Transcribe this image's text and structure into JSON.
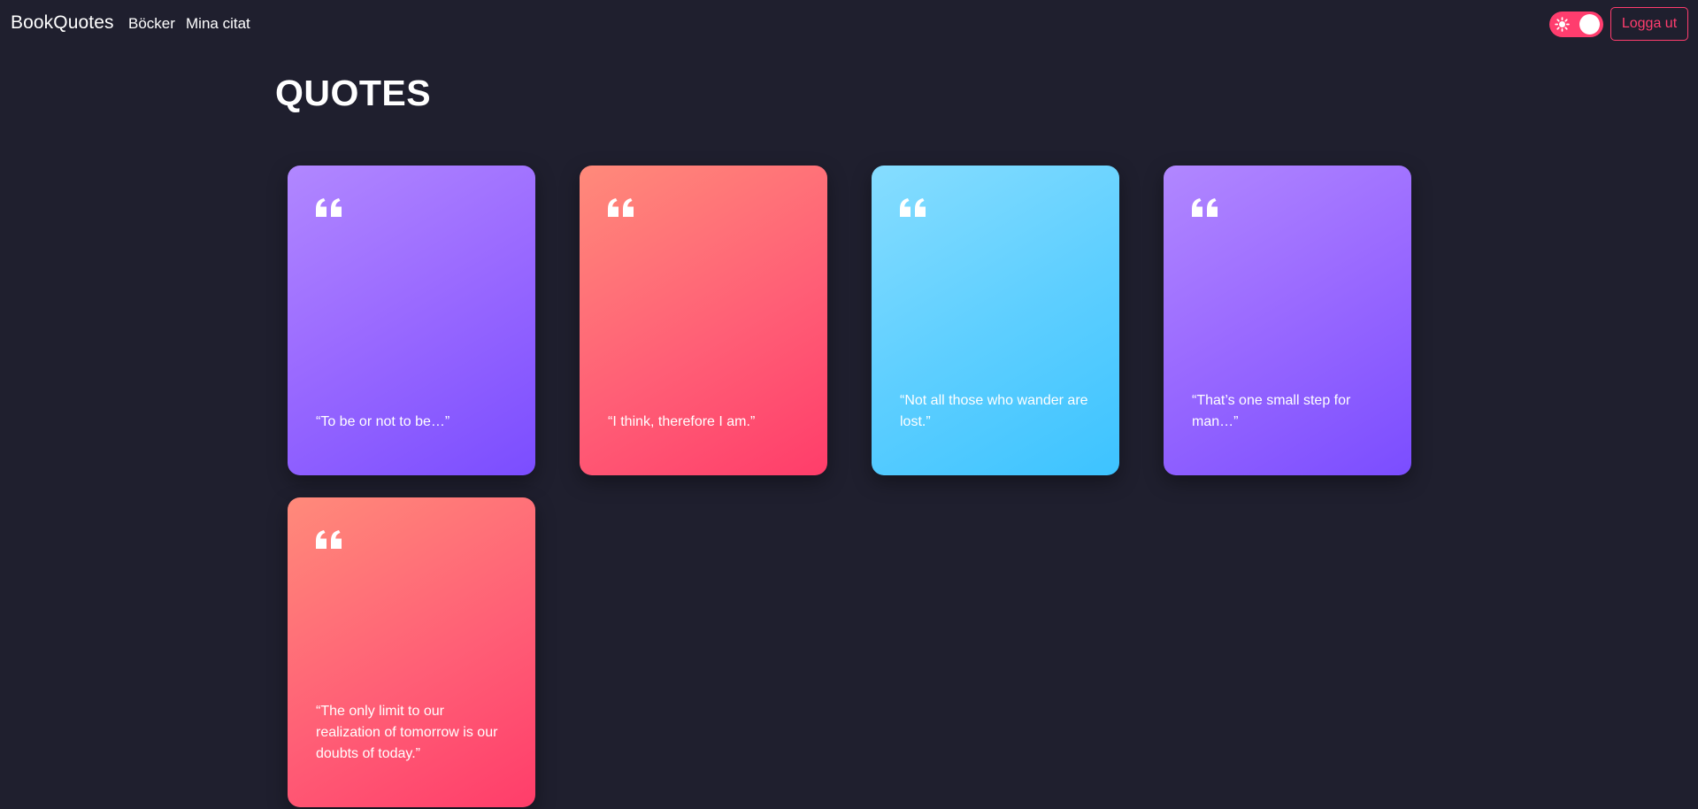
{
  "navbar": {
    "brand": "BookQuotes",
    "links": [
      {
        "label": "Böcker"
      },
      {
        "label": "Mina citat"
      }
    ],
    "theme_toggle": {
      "icon": "sun-icon",
      "on": true,
      "color": "#ff3d6e"
    },
    "logout_label": "Logga ut"
  },
  "main": {
    "title": "QUOTES",
    "cards": [
      {
        "text": "“To be or not to be…”",
        "color": "purple"
      },
      {
        "text": "“I think, therefore I am.”",
        "color": "coral"
      },
      {
        "text": "“Not all those who wander are lost.”",
        "color": "sky"
      },
      {
        "text": "“That’s one small step for man…”",
        "color": "purple"
      },
      {
        "text": "“The only limit to our realization of tomorrow is our doubts of today.”",
        "color": "coral"
      }
    ]
  },
  "colors": {
    "background": "#1f1f2e",
    "accent": "#ff3d6e",
    "purple": "#9b6bff",
    "coral": "#ff5f76",
    "sky": "#5fcfff"
  }
}
